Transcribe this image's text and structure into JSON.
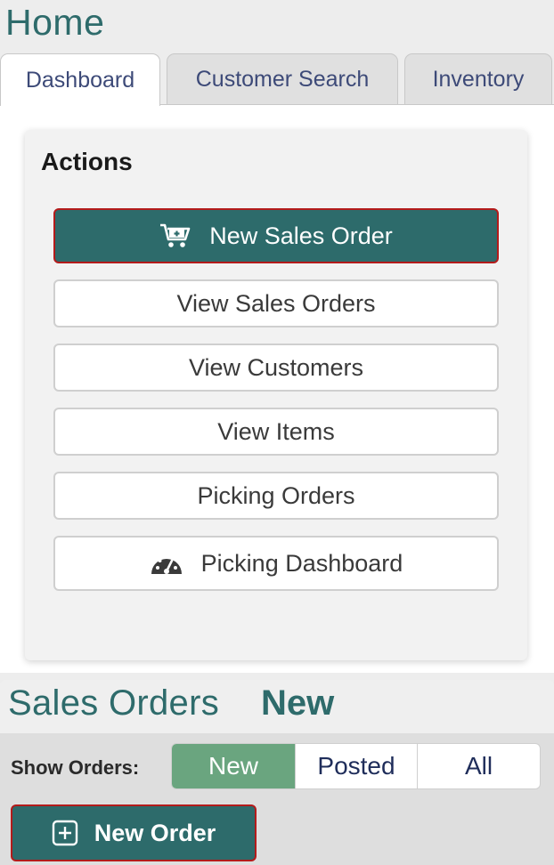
{
  "home": {
    "title": "Home",
    "tabs": [
      {
        "label": "Dashboard",
        "active": true
      },
      {
        "label": "Customer Search",
        "active": false
      },
      {
        "label": "Inventory",
        "active": false
      }
    ]
  },
  "actions": {
    "heading": "Actions",
    "buttons": [
      {
        "label": "New Sales Order",
        "icon": "cart-plus-icon",
        "primary": true
      },
      {
        "label": "View Sales Orders"
      },
      {
        "label": "View Customers"
      },
      {
        "label": "View Items"
      },
      {
        "label": "Picking Orders"
      },
      {
        "label": "Picking Dashboard",
        "icon": "speedometer-icon"
      }
    ]
  },
  "sales_orders": {
    "title": "Sales Orders",
    "status": "New",
    "filter_label": "Show Orders:",
    "filters": [
      {
        "label": "New",
        "selected": true
      },
      {
        "label": "Posted",
        "selected": false
      },
      {
        "label": "All",
        "selected": false
      }
    ],
    "new_order_label": "New Order",
    "new_order_icon": "plus-square-icon"
  },
  "colors": {
    "primary": "#2d6b6b",
    "title_teal": "#2e6b6b",
    "selected_filter": "#6aa57f",
    "highlight_border": "#b31b1b",
    "tab_text": "#3d4a78"
  }
}
